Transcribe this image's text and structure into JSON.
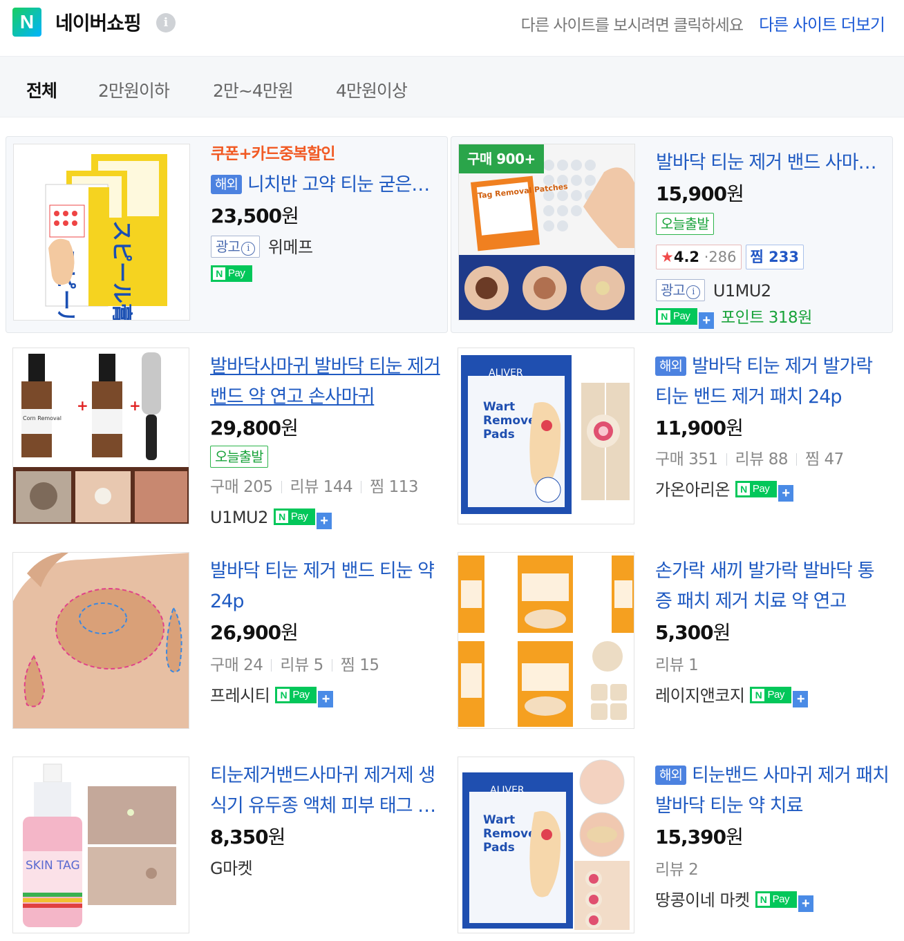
{
  "header": {
    "logo_letter": "N",
    "brand": "네이버쇼핑",
    "info_icon": "i",
    "hint": "다른 사이트를 보시려면 클릭하세요",
    "more_sites": "다른 사이트 더보기"
  },
  "tabs": [
    {
      "label": "전체",
      "active": true
    },
    {
      "label": "2만원이하",
      "active": false
    },
    {
      "label": "2만~4만원",
      "active": false
    },
    {
      "label": "4만원이상",
      "active": false
    }
  ],
  "labels": {
    "won": "원",
    "ad": "광고",
    "ad_info": "i",
    "today_ship": "오늘출발",
    "overseas": "해외",
    "npay_n": "N",
    "npay_pay": "Pay",
    "npay_plus": "+",
    "buy": "구매",
    "review": "리뷰",
    "zzim": "찜",
    "star": "★",
    "rating_sep": "·"
  },
  "products": [
    {
      "promo": "쿠폰+카드중복할인",
      "overseas": true,
      "title": "니치반 고약 티눈 굳은살 제거 패치",
      "price": "23,500",
      "ad": true,
      "mall": "위메프",
      "npay": true
    },
    {
      "buy_badge": "구매 900+",
      "thumb_text": "Tag Removal Patches",
      "title": "발바닥 티눈 제거 밴드 사마귀 패치",
      "price": "15,900",
      "today_ship": true,
      "rating": "4.2",
      "rating_count": "286",
      "zzim_count": "233",
      "ad": true,
      "mall": "U1MU2",
      "npay_plus": true,
      "point": "포인트 318원"
    },
    {
      "title": "발바닥사마귀 발바닥 티눈 제거 밴드 약 연고 손사마귀",
      "thumb_text": "Corn Removal",
      "price": "29,800",
      "today_ship": true,
      "buy_count": "205",
      "review_count": "144",
      "zzim_count": "113",
      "mall": "U1MU2",
      "npay_plus": true
    },
    {
      "overseas": true,
      "title": "발바닥 티눈 제거 발가락 티눈 밴드 제거 패치 24p",
      "thumb_text": [
        "ALIVER",
        "Wart",
        "Remover",
        "Pads"
      ],
      "price": "11,900",
      "buy_count": "351",
      "review_count": "88",
      "zzim_count": "47",
      "mall": "가온아리온",
      "npay_plus": true
    },
    {
      "title": "발바닥 티눈 제거 밴드 티눈 약 24p",
      "price": "26,900",
      "buy_count": "24",
      "review_count": "5",
      "zzim_count": "15",
      "mall": "프레시티",
      "npay_plus": true
    },
    {
      "title": "손가락 새끼 발가락 발바닥 통증 패치 제거 치료 약 연고",
      "price": "5,300",
      "review_count": "1",
      "mall": "레이지앤코지",
      "npay_plus": true
    },
    {
      "title": "티눈제거밴드사마귀 제거제 생식기 유두종 액체 피부 태그 제거",
      "thumb_text": "SKIN TAG",
      "price": "8,350",
      "mall": "G마켓"
    },
    {
      "overseas": true,
      "title": "티눈밴드 사마귀 제거 패치 발바닥 티눈 약 치료",
      "thumb_text": [
        "ALIVER",
        "Wart",
        "Remover",
        "Pads"
      ],
      "price": "15,390",
      "review_count": "2",
      "mall": "땅콩이네 마켓",
      "npay_plus": true
    }
  ]
}
